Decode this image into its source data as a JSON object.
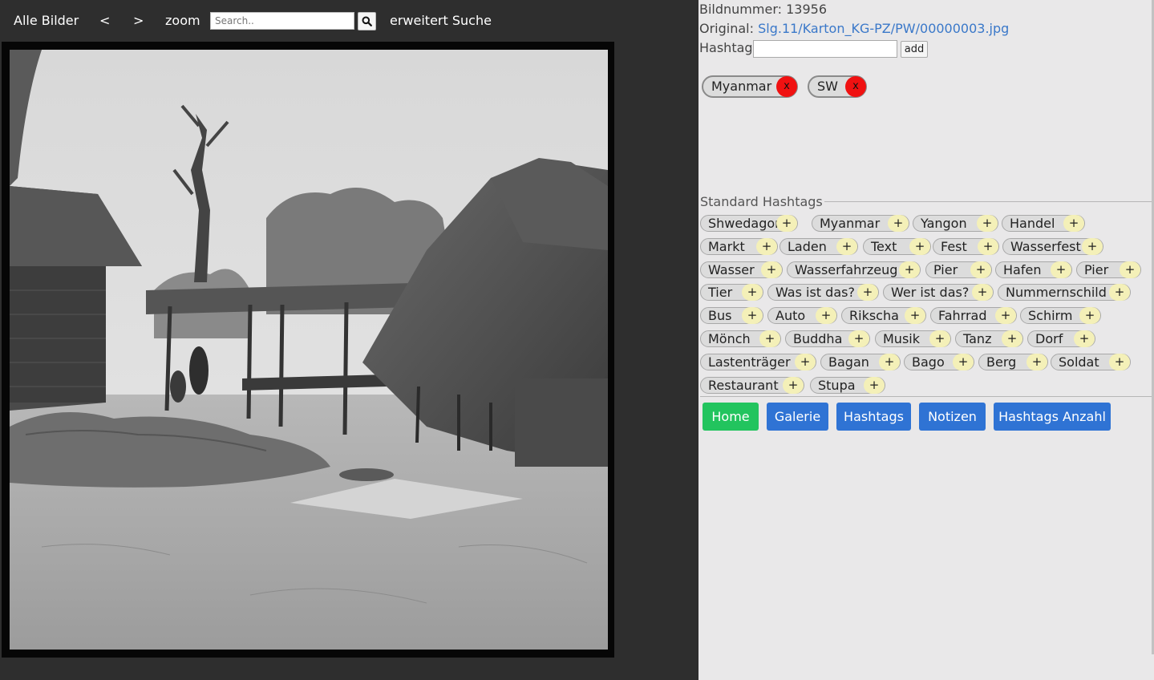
{
  "topnav": {
    "all_images": "Alle Bilder",
    "prev": "<",
    "next": ">",
    "zoom": "zoom",
    "search_placeholder": "Search..",
    "search_icon": "search-icon",
    "advanced_search": "erweitert Suche"
  },
  "photo": {
    "description_icon": "village-photo"
  },
  "info": {
    "image_number_label": "Bildnummer:",
    "image_number": "13956",
    "original_label": "Original:",
    "original_link": "Slg.11/Karton_KG-PZ/PW/00000003.jpg",
    "hashtag_label": "Hashtag:",
    "hashtag_value": "",
    "add_label": "add"
  },
  "current_tags": [
    {
      "label": "Myanmar",
      "remove": "x"
    },
    {
      "label": "SW",
      "remove": "x"
    }
  ],
  "standard_hashtags": {
    "title": "Standard Hashtags",
    "plus": "+",
    "tags": [
      "Shwedagon",
      "Myanmar",
      "Yangon",
      "Handel",
      "Markt",
      "Laden",
      "Text",
      "Fest",
      "Wasserfest",
      "Wasser",
      "Wasserfahrzeug",
      "Pier",
      "Hafen",
      "Pier",
      "Tier",
      "Was ist das?",
      "Wer ist das?",
      "Nummernschild",
      "Bus",
      "Auto",
      "Rikscha",
      "Fahrrad",
      "Schirm",
      "Mönch",
      "Buddha",
      "Musik",
      "Tanz",
      "Dorf",
      "Lastenträger",
      "Bagan",
      "Bago",
      "Berg",
      "Soldat",
      "Restaurant",
      "Stupa"
    ]
  },
  "nav_buttons": {
    "home": "Home",
    "gallery": "Galerie",
    "hashtags": "Hashtags",
    "notes": "Notizen",
    "hashtag_count": "Hashtags Anzahl"
  },
  "colors": {
    "dark_bg": "#2e2e2e",
    "panel_bg": "#e9e8e9",
    "link": "#3a78c9",
    "home_button": "#22c45e",
    "nav_button": "#2f73d4",
    "remove_tag": "#f01111",
    "plus_bg": "#f4f0b8"
  }
}
